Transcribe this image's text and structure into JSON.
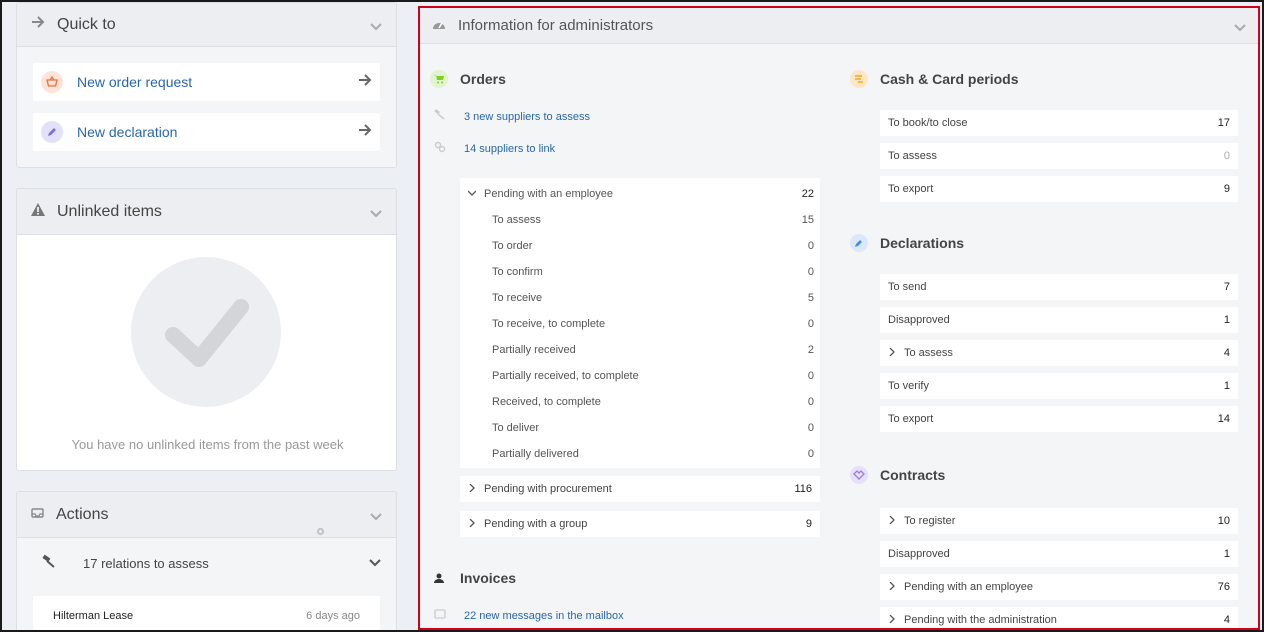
{
  "quick_to": {
    "title": "Quick to",
    "items": [
      {
        "label": "New order request",
        "icon": "basket-icon"
      },
      {
        "label": "New declaration",
        "icon": "pencil-icon"
      }
    ]
  },
  "unlinked": {
    "title": "Unlinked items",
    "empty_text": "You have no unlinked items from the past week"
  },
  "actions": {
    "title": "Actions",
    "relations_label": "17 relations to assess",
    "entry_name": "Hilterman Lease",
    "entry_time": "6 days ago"
  },
  "admin": {
    "title": "Information for administrators",
    "orders": {
      "title": "Orders",
      "suppliers_assess": "3 new suppliers to assess",
      "suppliers_link": "14 suppliers to link",
      "pending_employee": {
        "label": "Pending with an employee",
        "value": "22"
      },
      "sub": [
        {
          "label": "To assess",
          "value": "15"
        },
        {
          "label": "To order",
          "value": "0"
        },
        {
          "label": "To confirm",
          "value": "0"
        },
        {
          "label": "To receive",
          "value": "5"
        },
        {
          "label": "To receive, to complete",
          "value": "0"
        },
        {
          "label": "Partially received",
          "value": "2"
        },
        {
          "label": "Partially received, to complete",
          "value": "0"
        },
        {
          "label": "Received, to complete",
          "value": "0"
        },
        {
          "label": "To deliver",
          "value": "0"
        },
        {
          "label": "Partially delivered",
          "value": "0"
        }
      ],
      "pending_procurement": {
        "label": "Pending with procurement",
        "value": "116"
      },
      "pending_group": {
        "label": "Pending with a group",
        "value": "9"
      }
    },
    "invoices": {
      "title": "Invoices",
      "mailbox": "22 new messages in the mailbox"
    },
    "cash": {
      "title": "Cash & Card periods",
      "rows": [
        {
          "label": "To book/to close",
          "value": "17"
        },
        {
          "label": "To assess",
          "value": "0"
        },
        {
          "label": "To export",
          "value": "9"
        }
      ]
    },
    "declarations": {
      "title": "Declarations",
      "rows": [
        {
          "label": "To send",
          "value": "7"
        },
        {
          "label": "Disapproved",
          "value": "1"
        },
        {
          "label": "To assess",
          "value": "4"
        },
        {
          "label": "To verify",
          "value": "1"
        },
        {
          "label": "To export",
          "value": "14"
        }
      ]
    },
    "contracts": {
      "title": "Contracts",
      "rows": [
        {
          "label": "To register",
          "value": "10"
        },
        {
          "label": "Disapproved",
          "value": "1"
        },
        {
          "label": "Pending with an employee",
          "value": "76"
        },
        {
          "label": "Pending with the administration",
          "value": "4"
        }
      ]
    }
  },
  "colors": {
    "accent_link": "#2a67a8",
    "highlight_border": "#d0021b",
    "orders_icon": "#7ed321",
    "cash_icon": "#f5a623",
    "decl_icon": "#4a90e2",
    "contracts_icon": "#9b7be0"
  }
}
